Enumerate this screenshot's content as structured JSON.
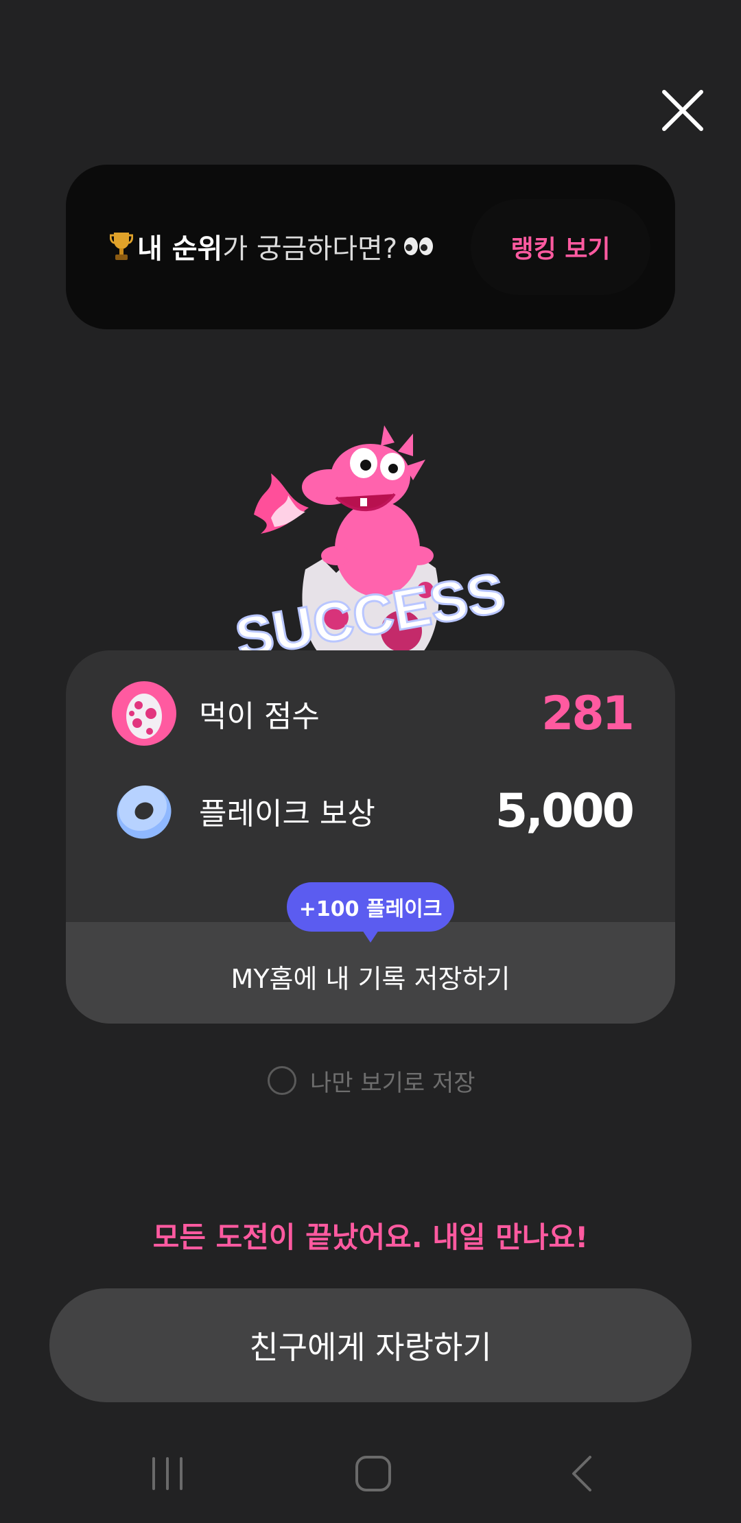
{
  "close": {
    "icon": "close-icon"
  },
  "rank_banner": {
    "text_bold": "내 순위",
    "text_rest": "가 궁금하다면?",
    "button_label": "랭킹 보기"
  },
  "mascot": {
    "icon": "dragon-success-illustration",
    "text": "SUCCESS"
  },
  "result": {
    "score_label": "먹이 점수",
    "score_value": "281",
    "reward_label": "플레이크 보상",
    "reward_value": "5,000",
    "bonus_pill": "+100 플레이크",
    "save_label": "MY홈에 내 기록 저장하기"
  },
  "private_save": {
    "label": "나만 보기로 저장",
    "checked": false
  },
  "done_message": "모든 도전이 끝났어요. 내일 만나요!",
  "share_button": "친구에게 자랑하기",
  "colors": {
    "accent": "#ff5aa0",
    "pill": "#5b5cf0",
    "background": "#222223"
  },
  "system_nav": {
    "icons": [
      "recent-apps-icon",
      "home-icon",
      "back-icon"
    ]
  }
}
